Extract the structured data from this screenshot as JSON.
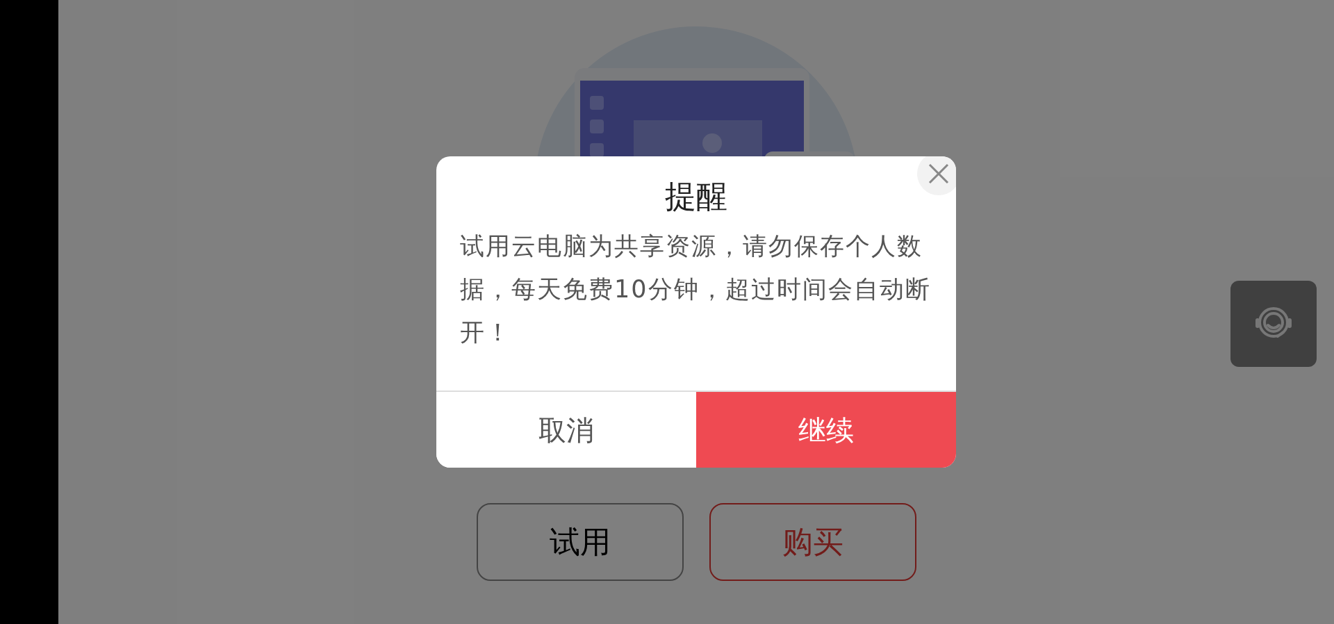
{
  "page": {
    "buttons": [
      {
        "label": "试用",
        "kind": "secondary"
      },
      {
        "label": "购买",
        "kind": "primary"
      }
    ]
  },
  "dialog": {
    "title": "提醒",
    "message": "试用云电脑为共享资源，请勿保存个人数据，每天免费10分钟，超过时间会自动断开！",
    "buttons": [
      {
        "label": "取消",
        "kind": "cancel"
      },
      {
        "label": "继续",
        "kind": "confirm"
      }
    ]
  }
}
